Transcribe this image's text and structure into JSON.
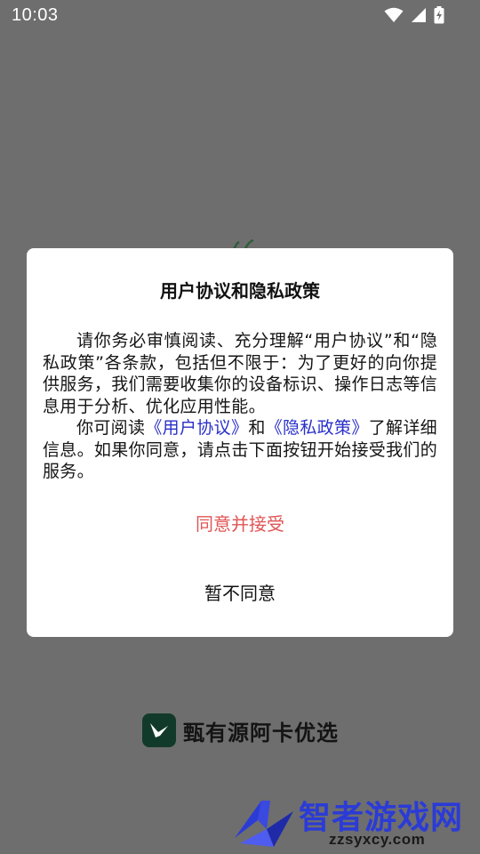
{
  "status_bar": {
    "time": "10:03"
  },
  "dialog": {
    "title": "用户协议和隐私政策",
    "paragraph1": "请你务必审慎阅读、充分理解“用户协议”和“隐私政策”各条款，包括但不限于：为了更好的向你提供服务，我们需要收集你的设备标识、操作日志等信息用于分析、优化应用性能。",
    "paragraph2_prefix": "你可阅读",
    "user_agreement_link": "《用户协议》",
    "paragraph2_and": "和",
    "privacy_policy_link": "《隐私政策》",
    "paragraph2_suffix": "了解详细信息。如果你同意，请点击下面按钮开始接受我们的服务。",
    "accept_label": "同意并接受",
    "decline_label": "暂不同意"
  },
  "app": {
    "name": "甄有源阿卡优选"
  },
  "watermark": {
    "title": "智者游戏网",
    "url": "zzsyxcy.com"
  },
  "colors": {
    "overlay_bg": "#6e6e6e",
    "accept": "#e05555",
    "link": "#2a2fc9",
    "logo_bg": "#123a2a",
    "watermark": "#2b3bd6"
  },
  "icons": {
    "wifi": "wifi-icon",
    "signal": "cell-signal-icon",
    "battery": "battery-charging-icon",
    "app_logo": "bird-logo-icon"
  }
}
